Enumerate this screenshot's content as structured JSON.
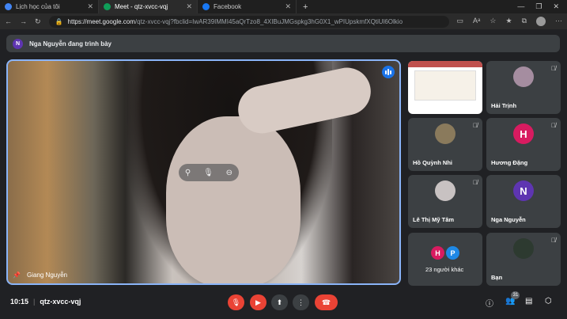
{
  "browser": {
    "tabs": [
      {
        "label": "Lịch học của tôi",
        "color": "#4285f4"
      },
      {
        "label": "Meet - qtz-xvcc-vqj",
        "color": "#0f9d58"
      },
      {
        "label": "Facebook",
        "color": "#1877f2"
      }
    ],
    "url_host": "https://meet.google.com",
    "url_path": "/qtz-xvcc-vqj?fbclid=IwAR39IMMI45aQrTzo8_4XIBuJMGspkg3hG0X1_wPIUpskmfXQtiUl6Olkio"
  },
  "presenting": {
    "initial": "N",
    "initial_color": "#5e35b1",
    "text": "Nga Nguyễn đang trình bày"
  },
  "main_speaker": {
    "name": "Giang Nguyễn"
  },
  "participants": [
    {
      "name": "",
      "kind": "slide"
    },
    {
      "name": "Hải Trịnh",
      "kind": "photo",
      "color": "#a58da0",
      "muted": true
    },
    {
      "name": "Hồ Quỳnh Nhi",
      "kind": "photo",
      "color": "#8a7a5c",
      "muted": true
    },
    {
      "name": "Hương Đặng",
      "kind": "letter",
      "letter": "H",
      "color": "#d81b60",
      "muted": true
    },
    {
      "name": "Lê Thị Mỹ Tâm",
      "kind": "photo",
      "color": "#c8c2c2",
      "muted": true
    },
    {
      "name": "Nga Nguyễn",
      "kind": "letter",
      "letter": "N",
      "color": "#5e35b1",
      "muted": false
    },
    {
      "name": "23 người khác",
      "kind": "group",
      "letters": [
        "H",
        "P"
      ],
      "colors": [
        "#d81b60",
        "#1e88e5"
      ]
    },
    {
      "name": "Bạn",
      "kind": "photo",
      "color": "#2d3a30",
      "muted": true
    }
  ],
  "footer": {
    "time": "10:15",
    "meeting_code": "qtz-xvcc-vqj",
    "people_count": "31"
  }
}
